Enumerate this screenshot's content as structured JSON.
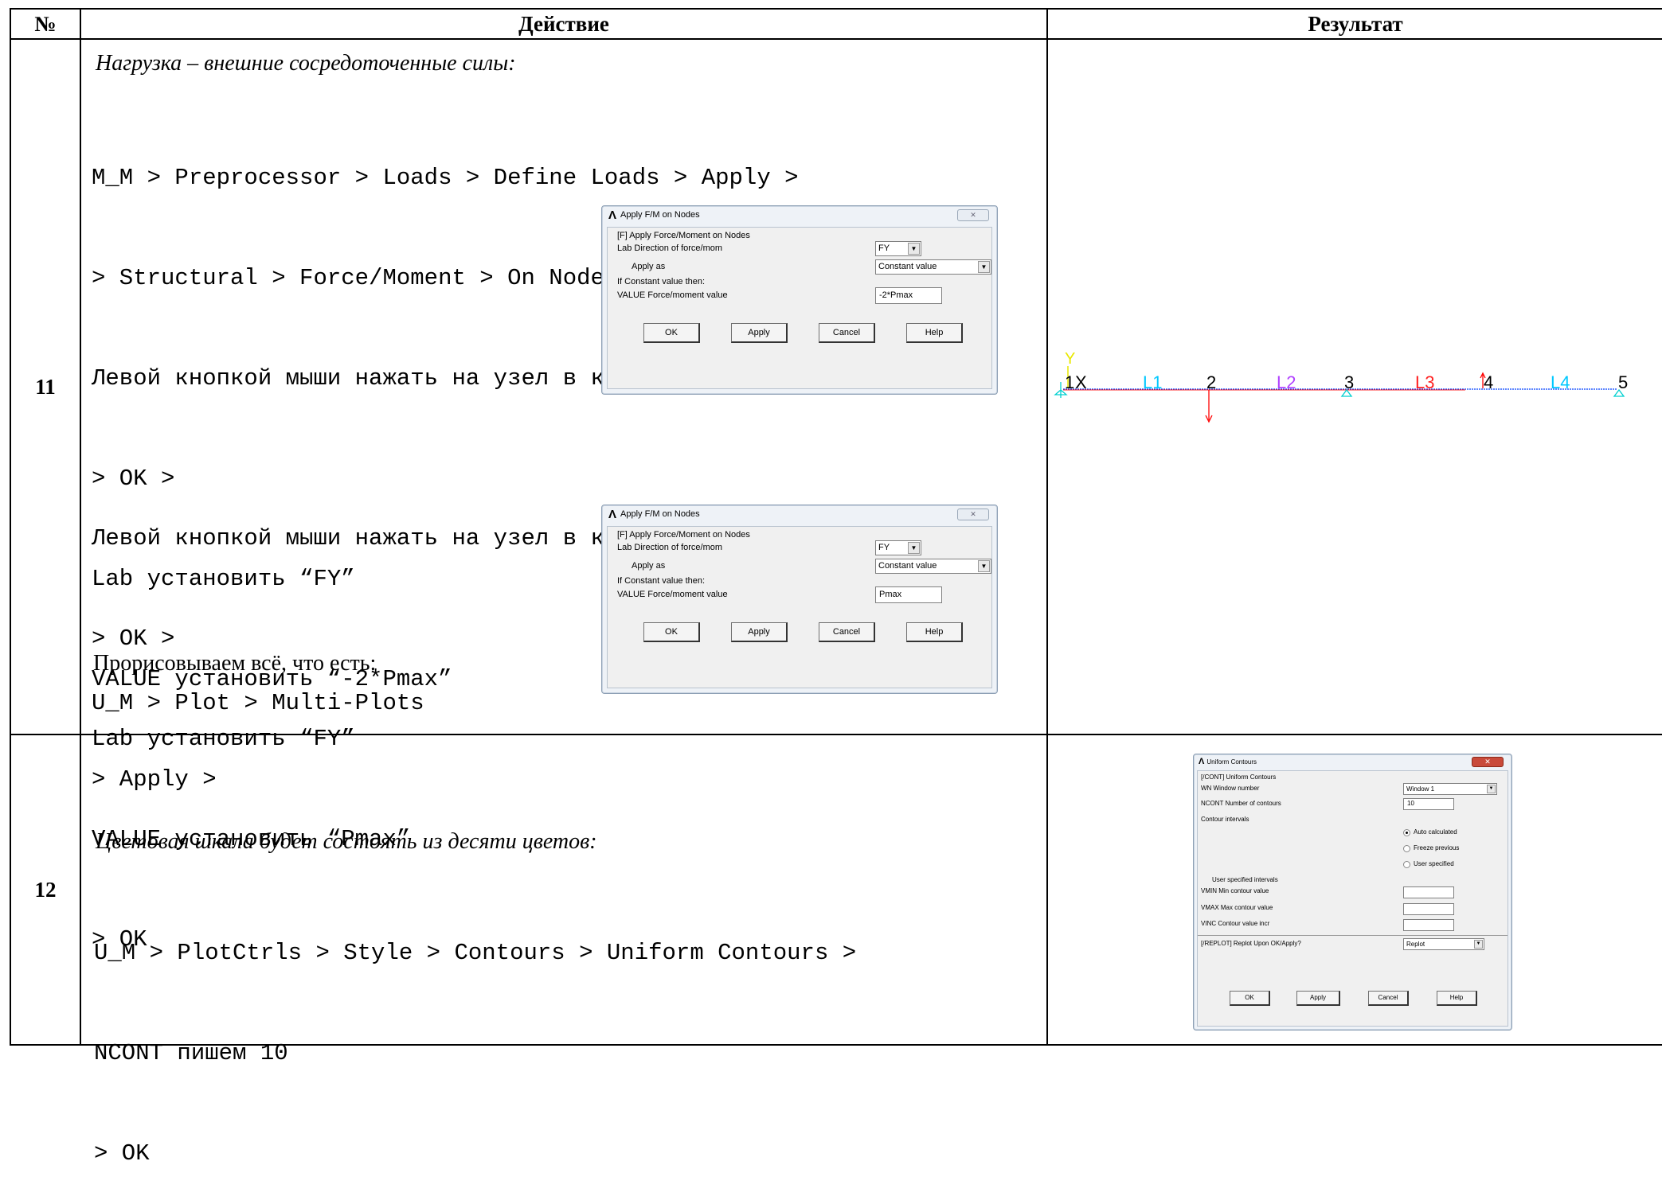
{
  "table": {
    "headers": [
      "№",
      "Действие",
      "Результат"
    ]
  },
  "row11": {
    "number": "11",
    "heading": "Нагрузка – внешние сосредоточенные силы:",
    "lines1": [
      "M_M > Preprocessor > Loads > Define Loads > Apply >",
      "> Structural > Force/Moment > On Nodes >",
      "Левой кнопкой мыши нажать на узел в ключевой точке 2",
      "> OK >",
      "Lab установить “FY”",
      "VALUE установить “-2*Pmax”",
      "> Apply >"
    ],
    "lines2": [
      "Левой кнопкой мыши нажать на узел в ключевой точке 4",
      "> OK >",
      "Lab установить “FY”",
      "VALUE установить “Pmax”",
      "> OK"
    ],
    "plot_note": "Прорисовываем всё, что есть:",
    "plot_path": "U_M > Plot > Multi-Plots",
    "dialog1": {
      "logo": "Λ",
      "title": "Apply F/M on Nodes",
      "close": "✕",
      "header": "[F]  Apply Force/Moment on Nodes",
      "lab_label": "Lab    Direction of force/mom",
      "lab_value": "FY",
      "apply_as_label": "Apply as",
      "apply_as_value": "Constant value",
      "if_const": "If Constant value then:",
      "value_label": "VALUE  Force/moment value",
      "value_value": "-2*Pmax",
      "buttons": [
        "OK",
        "Apply",
        "Cancel",
        "Help"
      ]
    },
    "dialog2": {
      "logo": "Λ",
      "title": "Apply F/M on Nodes",
      "close": "✕",
      "header": "[F]  Apply Force/Moment on Nodes",
      "lab_label": "Lab    Direction of force/mom",
      "lab_value": "FY",
      "apply_as_label": "Apply as",
      "apply_as_value": "Constant value",
      "if_const": "If Constant value then:",
      "value_label": "VALUE  Force/moment value",
      "value_value": "Pmax",
      "buttons": [
        "OK",
        "Apply",
        "Cancel",
        "Help"
      ]
    },
    "model": {
      "axis_y": "Y",
      "axis_x": "X",
      "kp_1": "1",
      "kp_2": "2",
      "kp_3": "3",
      "kp_4": "4",
      "kp_5": "5",
      "line_1": "L1",
      "line_2": "L2",
      "line_3": "L3",
      "line_4": "L4",
      "colors": {
        "l1": "#00c8ff",
        "l2": "#b040ff",
        "l3": "#ff2020",
        "l4": "#00c8ff",
        "beam": "#0040ff",
        "support": "#00d0d0",
        "force": "#ff0000"
      }
    }
  },
  "row12": {
    "number": "12",
    "heading": "Цветовая шкала будет состоять из десяти цветов:",
    "lines": [
      "U_M > PlotCtrls > Style > Contours > Uniform Contours >",
      "NCONT пишем 10",
      "> OK"
    ],
    "dialog": {
      "logo": "Λ",
      "title": "Uniform Contours",
      "close": "✕",
      "header": "[/CONT]  Uniform Contours",
      "wn_label": "WN    Window number",
      "wn_value": "Window 1",
      "ncont_label": "NCONT  Number of contours",
      "ncont_value": "10",
      "intervals": "Contour intervals",
      "radio_auto": "Auto calculated",
      "radio_freeze": "Freeze previous",
      "radio_user": "User specified",
      "user_intervals": "User specified intervals",
      "vmin": "VMIN   Min contour value",
      "vmax": "VMAX   Max contour value",
      "vinc": "VINC   Contour value incr",
      "replot_label": "[/REPLOT]  Replot Upon OK/Apply?",
      "replot_value": "Replot",
      "buttons": [
        "OK",
        "Apply",
        "Cancel",
        "Help"
      ]
    }
  }
}
